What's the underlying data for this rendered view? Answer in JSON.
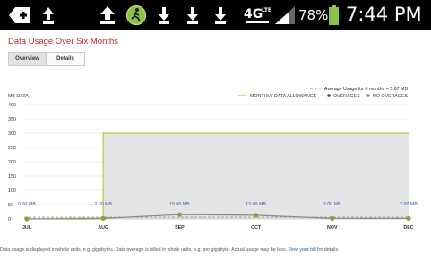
{
  "status_bar": {
    "battery_percent": "78%",
    "network": "4G LTE",
    "time": "7:44 PM"
  },
  "page": {
    "title": "Data Usage Over Six Months"
  },
  "tabs": [
    {
      "label": "Overview",
      "active": true
    },
    {
      "label": "Details",
      "active": false
    }
  ],
  "footnote": {
    "text": "Data usage is displayed in whole units, e.g. gigabytes. Data overage is billed in whole units, e.g. per gigabyte. Actual usage may be less. ",
    "link_text": "View your bill",
    "suffix": " for details"
  },
  "chart_data": {
    "type": "line",
    "ylabel": "MB DATA",
    "ylim": [
      0,
      400
    ],
    "yticks": [
      0,
      50,
      100,
      150,
      200,
      250,
      300,
      350,
      400
    ],
    "categories": [
      "JUL",
      "AUG",
      "SEP",
      "OCT",
      "NOV",
      "DEC"
    ],
    "average_label": "Average Usage for 6 months = 5.67 MB",
    "average_value": 5.67,
    "legend": [
      {
        "label": "MONTHLY DATA ALLOWANCE",
        "color": "#b7c93a"
      },
      {
        "label": "OVERAGES",
        "color": "#8b2636"
      },
      {
        "label": "NO OVERAGES",
        "color": "#7aa83a"
      }
    ],
    "series": [
      {
        "name": "MONTHLY DATA ALLOWANCE",
        "values": [
          0,
          300,
          300,
          300,
          300,
          300
        ]
      },
      {
        "name": "NO OVERAGES",
        "values": [
          0,
          2,
          15,
          13,
          2,
          2
        ]
      }
    ],
    "data_labels": [
      "0.00 MB",
      "2.00 MB",
      "15.00 MB",
      "13.00 MB",
      "2.00 MB",
      "2.00 MB"
    ],
    "colors": {
      "allowance": "#b7c93a",
      "usage_line": "#8a8a8a",
      "point": "#7aa83a",
      "data_label": "#3a56b8",
      "average_line": "#9a9a9a",
      "fill": "#e4e4e4",
      "grid": "#e6e6e6"
    }
  }
}
